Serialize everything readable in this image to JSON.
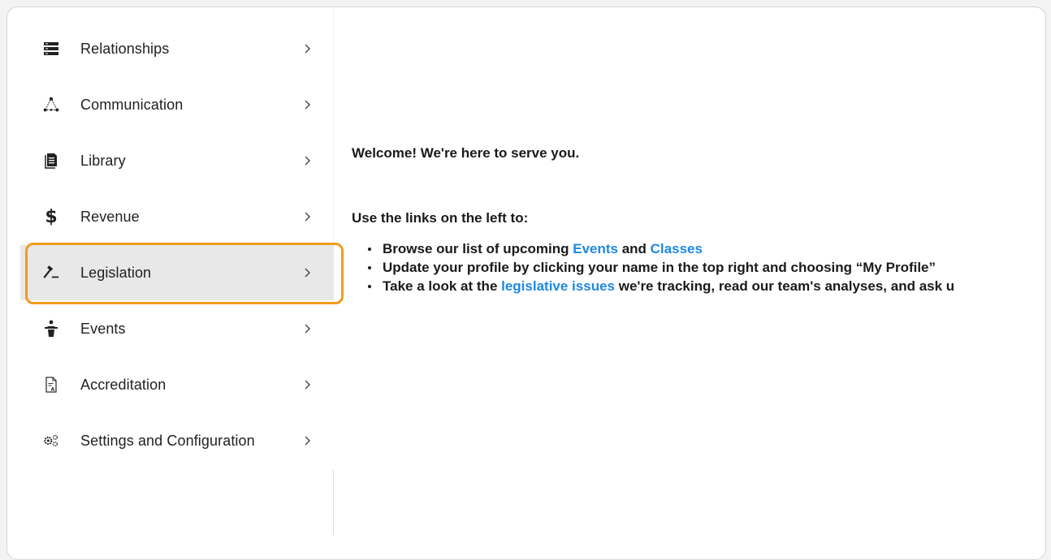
{
  "sidebar": {
    "items": [
      {
        "label": "Relationships",
        "icon": "server-stack-icon"
      },
      {
        "label": "Communication",
        "icon": "network-nodes-icon"
      },
      {
        "label": "Library",
        "icon": "document-icon"
      },
      {
        "label": "Revenue",
        "icon": "dollar-icon"
      },
      {
        "label": "Legislation",
        "icon": "gavel-icon",
        "active": true
      },
      {
        "label": "Events",
        "icon": "podium-person-icon"
      },
      {
        "label": "Accreditation",
        "icon": "certificate-doc-icon"
      },
      {
        "label": "Settings and Configuration",
        "icon": "gears-icon"
      }
    ],
    "chevron": "›"
  },
  "main": {
    "welcome": "Welcome!  We're here to serve you.",
    "intro": "Use the links on the left to:",
    "bullet1": {
      "prefix": "Browse our list of upcoming ",
      "link1": "Events",
      "middle": " and ",
      "link2": "Classes"
    },
    "bullet2": {
      "text": "Update your profile by clicking your name in the top right and choosing “My Profile”"
    },
    "bullet3": {
      "prefix": "Take a look at the ",
      "link": "legislative issues",
      "suffix": " we're tracking, read our team's analyses, and ask u"
    }
  },
  "colors": {
    "accent_link": "#1e88e5",
    "highlight": "#f39a1e",
    "active_bg": "#e8e8e8"
  }
}
